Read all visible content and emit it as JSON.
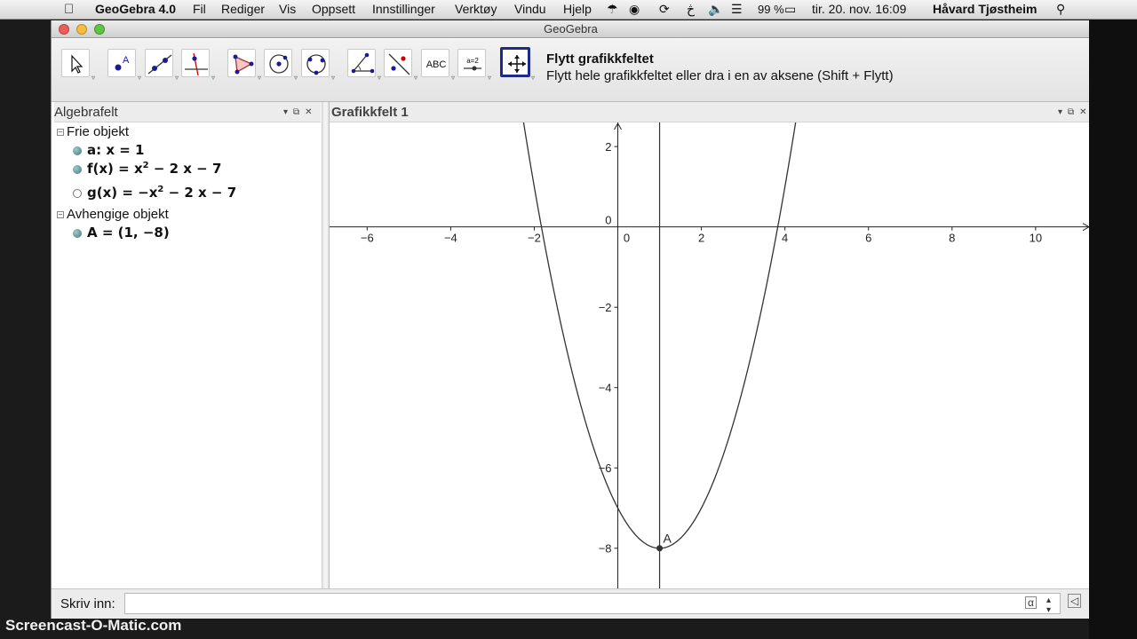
{
  "menubar": {
    "app_name": "GeoGebra 4.0",
    "items": [
      "Fil",
      "Rediger",
      "Vis",
      "Oppsett",
      "Innstillinger",
      "Verktøy",
      "Vindu",
      "Hjelp"
    ],
    "battery": "99 %",
    "datetime": "tir. 20. nov.  16:09",
    "user": "Håvard Tjøstheim"
  },
  "window": {
    "title": "GeoGebra"
  },
  "toolbar": {
    "tools": [
      "move-tool",
      "point-tool",
      "line-tool",
      "perpendicular-line-tool",
      "polygon-tool",
      "circle-tool",
      "conic-tool",
      "angle-tool",
      "reflect-tool",
      "text-tool",
      "slider-tool",
      "move-graphics-view-tool"
    ],
    "text_tool_label": "ABC",
    "slider_tool_label": "a=2",
    "active_tool_title": "Flytt grafikkfeltet",
    "active_tool_help": "Flytt hele grafikkfeltet eller dra i en av aksene (Shift + Flytt)"
  },
  "algebra": {
    "header": "Algebrafelt",
    "free_group": "Frie objekt",
    "free_items": [
      {
        "label": "a: x = 1"
      },
      {
        "name": "f(x) = ",
        "expr": "x",
        "sup": "2",
        "tail": " − 2 x − 7"
      },
      {
        "name": "g(x) = ",
        "expr": "−x",
        "sup": "2",
        "tail": " − 2 x − 7"
      }
    ],
    "dependent_group": "Avhengige objekt",
    "dependent_items": [
      {
        "label": "A = (1, −8)"
      }
    ]
  },
  "graphics": {
    "header": "Grafikkfelt 1",
    "point_label": "A"
  },
  "chart_data": {
    "type": "line",
    "title": "",
    "xlabel": "",
    "ylabel": "",
    "xlim": [
      -6.9,
      11.3
    ],
    "ylim": [
      -9.0,
      2.6
    ],
    "x_ticks": [
      -6,
      -4,
      -2,
      0,
      2,
      4,
      6,
      8,
      10
    ],
    "y_ticks": [
      2,
      0,
      -2,
      -4,
      -6,
      -8
    ],
    "series": [
      {
        "name": "f(x) = x² − 2x − 7",
        "function": "x^2 - 2x - 7",
        "visible": true
      },
      {
        "name": "g(x) = −x² − 2x − 7",
        "function": "-x^2 - 2x - 7",
        "visible": false
      }
    ],
    "lines": [
      {
        "name": "a",
        "equation": "x = 1"
      }
    ],
    "points": [
      {
        "name": "A",
        "x": 1,
        "y": -8
      }
    ],
    "grid": false,
    "colors": {
      "curve": "#333333",
      "axes": "#222222",
      "point": "#333333"
    }
  },
  "inputbar": {
    "label": "Skriv inn:",
    "value": "",
    "alpha_symbol": "α"
  },
  "watermark": "Screencast-O-Matic.com"
}
